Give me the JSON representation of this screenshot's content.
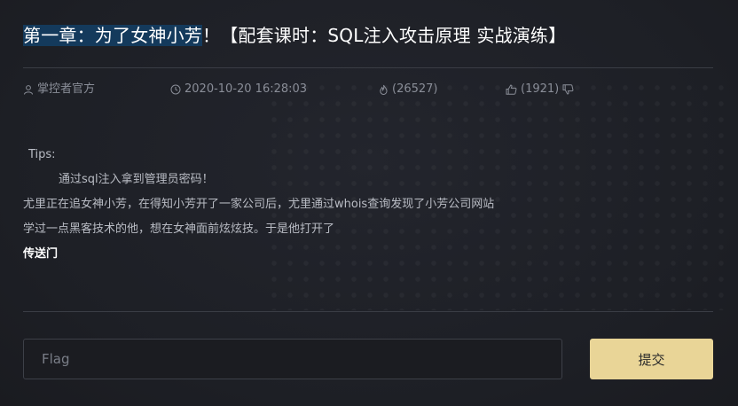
{
  "challenge": {
    "title_highlight": "第一章：为了女神小芳",
    "title_rest": "！【配套课时：SQL注入攻击原理 实战演练】"
  },
  "meta": {
    "author": "掌控者官方",
    "date": "2020-10-20 16:28:03",
    "views": "(26527)",
    "likes": "(1921)"
  },
  "content": {
    "tips_label": "Tips:",
    "tip_text": "通过sql注入拿到管理员密码！",
    "story_line1": "尤里正在追女神小芳，在得知小芳开了一家公司后，尤里通过whois查询发现了小芳公司网站",
    "story_line2": "学过一点黑客技术的他，想在女神面前炫炫技。于是他打开了",
    "portal_link": "传送门"
  },
  "form": {
    "flag_placeholder": "Flag",
    "submit_label": "提交"
  },
  "icons": {
    "author": "user-icon",
    "date": "clock-icon",
    "views": "fire-icon",
    "like": "thumbs-up-icon",
    "dislike": "thumbs-down-icon"
  },
  "colors": {
    "background": "#1e2027",
    "title_highlight": "#143a5c",
    "submit_button": "#e9d597"
  }
}
